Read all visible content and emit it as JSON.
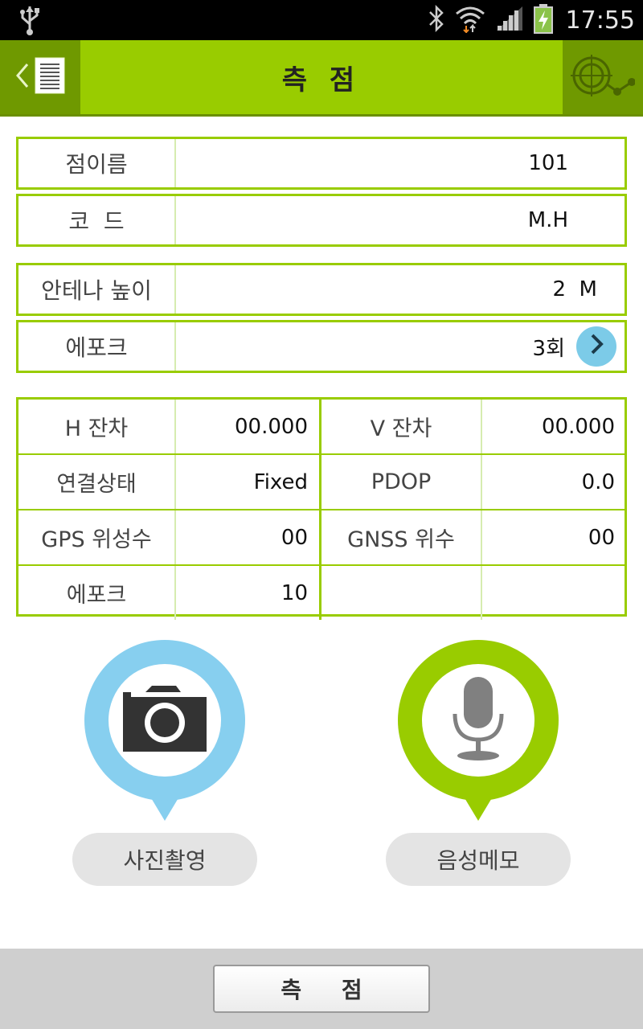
{
  "status_bar": {
    "time": "17:55",
    "icons": [
      "usb-icon",
      "bluetooth-icon",
      "wifi-icon",
      "signal-icon",
      "battery-charging-icon"
    ]
  },
  "header": {
    "title": "측 점",
    "left_icons": [
      "back-chevron-icon",
      "list-icon"
    ],
    "right_icon": "crosshair-icon"
  },
  "form": {
    "point_name": {
      "label": "점이름",
      "value": "101"
    },
    "code": {
      "label": "코  드",
      "value": "M.H"
    },
    "antenna_height": {
      "label": "안테나 높이",
      "value": "2  M"
    },
    "epoch": {
      "label": "에포크",
      "value": "3회"
    }
  },
  "status_table": {
    "rows": [
      {
        "l1": "H 잔차",
        "v1": "00.000",
        "l2": "V 잔차",
        "v2": "00.000"
      },
      {
        "l1": "연결상태",
        "v1": "Fixed",
        "l2": "PDOP",
        "v2": "0.0"
      },
      {
        "l1": "GPS 위성수",
        "v1": "00",
        "l2": "GNSS 위수",
        "v2": "00"
      },
      {
        "l1": "에포크",
        "v1": "10",
        "l2": "",
        "v2": ""
      }
    ]
  },
  "actions": {
    "photo_label": "사진촬영",
    "voice_label": "음성메모"
  },
  "footer": {
    "measure_label": "측 점"
  },
  "colors": {
    "accent_green": "#99cc00",
    "dark_green": "#6f9900",
    "accent_blue": "#87cfef"
  }
}
